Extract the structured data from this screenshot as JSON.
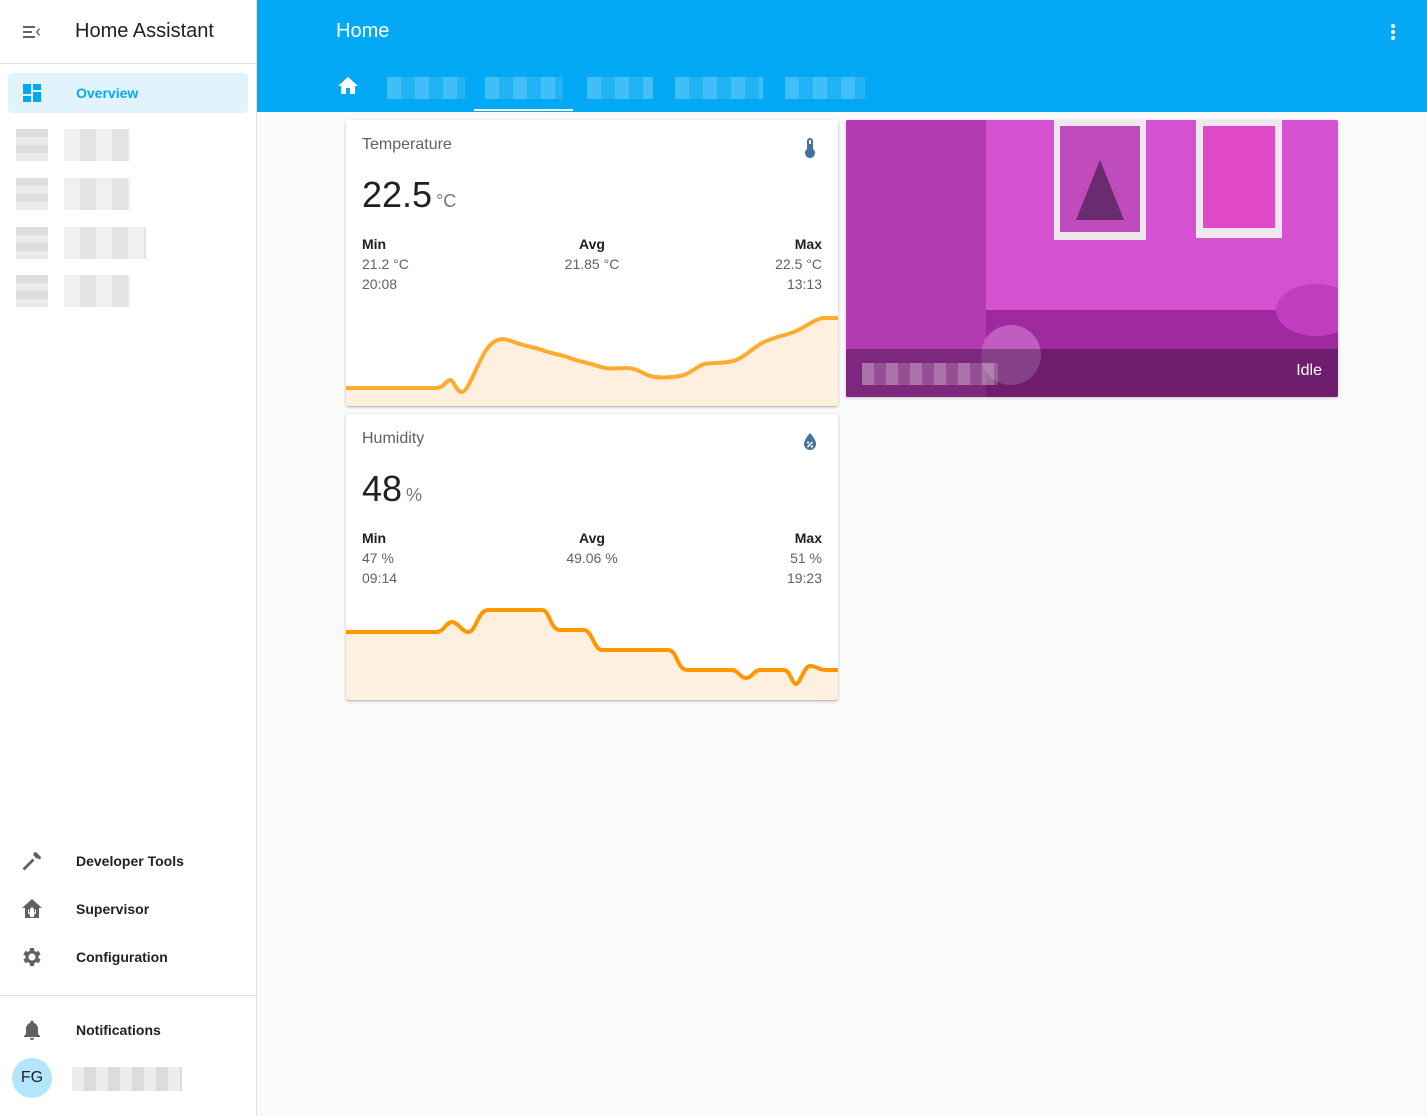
{
  "app": {
    "title": "Home Assistant"
  },
  "sidebar": {
    "menu_icon": "menu-open-icon",
    "overview": {
      "label": "Overview",
      "icon": "dashboard-icon"
    },
    "developer_tools": {
      "label": "Developer Tools",
      "icon": "hammer-icon"
    },
    "supervisor": {
      "label": "Supervisor",
      "icon": "home-assistant-icon"
    },
    "configuration": {
      "label": "Configuration",
      "icon": "gear-icon"
    },
    "notifications": {
      "label": "Notifications",
      "icon": "bell-icon"
    },
    "user": {
      "initials": "FG"
    }
  },
  "header": {
    "title": "Home",
    "home_tab_icon": "home-icon",
    "more_icon": "dots-vertical-icon"
  },
  "cards": {
    "temperature": {
      "name": "Temperature",
      "icon": "thermometer-icon",
      "value": "22.5",
      "unit": "°C",
      "min_label": "Min",
      "min_value": "21.2 °C",
      "min_time": "20:08",
      "avg_label": "Avg",
      "avg_value": "21.85 °C",
      "max_label": "Max",
      "max_value": "22.5 °C",
      "max_time": "13:13"
    },
    "humidity": {
      "name": "Humidity",
      "icon": "water-percent-icon",
      "value": "48",
      "unit": "%",
      "min_label": "Min",
      "min_value": "47 %",
      "min_time": "09:14",
      "avg_label": "Avg",
      "avg_value": "49.06 %",
      "max_label": "Max",
      "max_value": "51 %",
      "max_time": "19:23"
    },
    "camera": {
      "state": "Idle"
    }
  },
  "colors": {
    "primary": "#03a9f4",
    "graph_line": "#ff9800",
    "graph_fill": "#ffefdf",
    "icon_blue": "#44739e"
  }
}
